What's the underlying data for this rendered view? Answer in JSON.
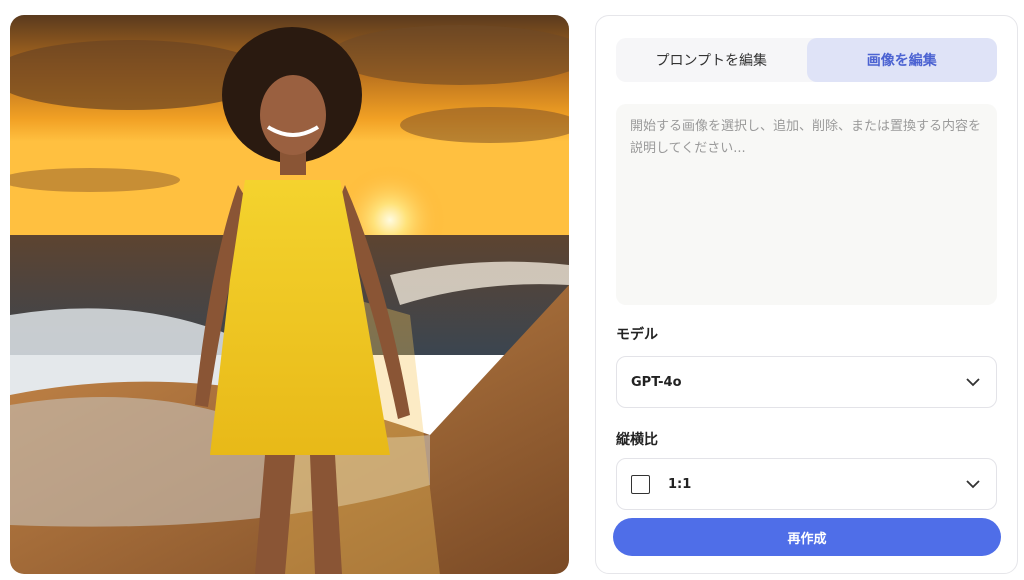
{
  "tabs": [
    {
      "label": "プロンプトを編集",
      "active": false
    },
    {
      "label": "画像を編集",
      "active": true
    }
  ],
  "prompt": {
    "value": "",
    "placeholder": "開始する画像を選択し、追加、削除、または置換する内容を説明してください..."
  },
  "model": {
    "label": "モデル",
    "selected": "GPT-4o",
    "icon": "chevron-down-icon"
  },
  "aspect_ratio": {
    "label": "縦横比",
    "selected": "1:1",
    "icons": [
      "square-ratio-icon",
      "chevron-down-icon"
    ]
  },
  "submit": {
    "label": "再作成"
  },
  "colors": {
    "accent": "#4f6ee8",
    "active_tab_bg": "#dfe3f7",
    "active_tab_text": "#4c63d2"
  }
}
